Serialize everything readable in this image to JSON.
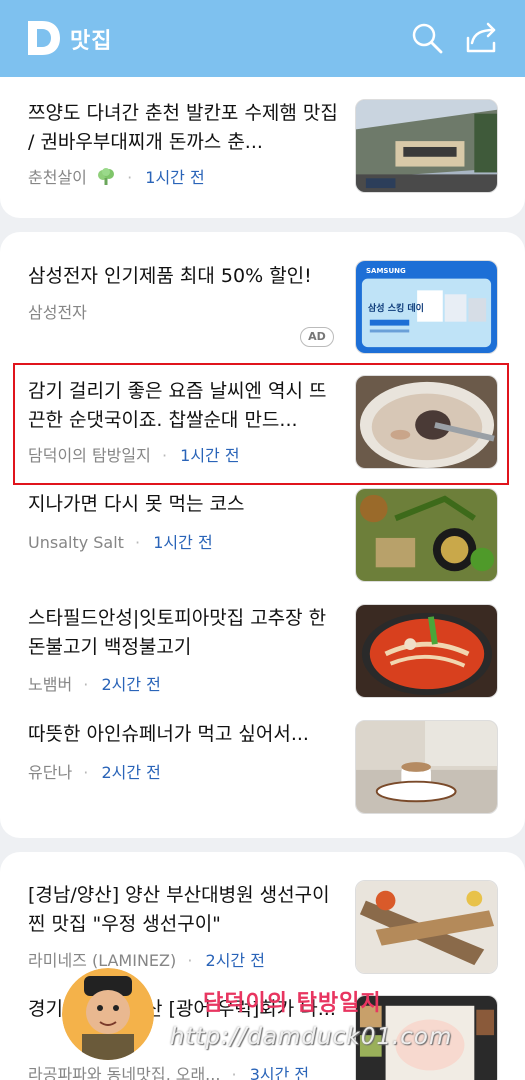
{
  "header": {
    "app_title": "맛집",
    "logo_letter": "D",
    "icons": [
      "search-icon",
      "share-icon"
    ],
    "background": "#7ec1ef"
  },
  "articles": [
    {
      "title": "쯔양도 다녀간 춘천 발칸포 수제햄 맛집 / 권바우부대찌개 돈까스 춘...",
      "source": "춘천살이",
      "time": "1시간 전",
      "source_icon": "broccoli-icon"
    },
    {
      "title": "삼성전자 인기제품 최대 50% 할인!",
      "source": "삼성전자",
      "time": "",
      "ad": "AD",
      "thumb_brand": "SAMSUNG",
      "thumb_text": "삼성 스킹 데이"
    },
    {
      "title": "감기 걸리기 좋은 요즘 날씨엔 역시 뜨끈한 순댓국이죠. 찹쌀순대 만드...",
      "source": "담덕이의 탐방일지",
      "time": "1시간 전",
      "highlighted": true
    },
    {
      "title": "지나가면 다시 못 먹는 코스",
      "source": "Unsalty Salt",
      "time": "1시간 전"
    },
    {
      "title": "스타필드안성|잇토피아맛집 고추장 한돈불고기 백정불고기",
      "source": "노뱀버",
      "time": "2시간 전"
    },
    {
      "title": "따뜻한 아인슈페너가 먹고 싶어서...",
      "source": "유단나",
      "time": "2시간 전"
    },
    {
      "title": "[경남/양산] 양산 부산대병원 생선구이 찐 맛집 \"우정 생선구이\"",
      "source": "라미네즈 (LAMINEZ)",
      "time": "2시간 전"
    },
    {
      "title": "경기 화성 이수산 [광어 우럭]회가 나...",
      "source": "라공파파와 동네맛집, 오래...",
      "time": "3시간 전"
    }
  ],
  "watermark": {
    "title": "담덕이의 탐방일지",
    "url": "http://damduck01.com"
  },
  "colors": {
    "time": "#2a64b8",
    "highlight_border": "#e0141c"
  }
}
